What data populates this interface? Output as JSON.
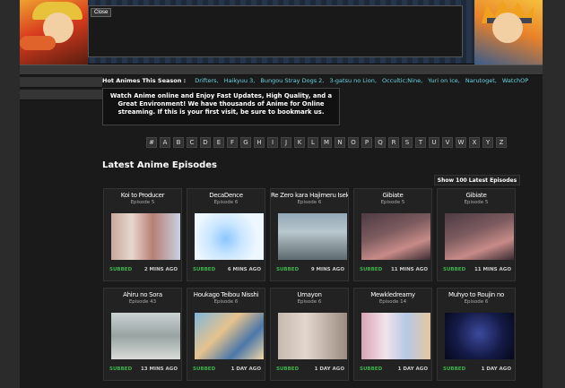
{
  "header": {
    "close_label": "Close"
  },
  "hot": {
    "label": "Hot Animes This Season :",
    "links": [
      "Drifters,",
      "Haikyuu 3,",
      "Bungou Stray Dogs 2,",
      "3-gatsu no Lion,",
      "Occultic;Nine,",
      "Yuri on Ice,",
      "Narutoget,",
      "WatchOP"
    ]
  },
  "welcome": "Watch Anime online and Enjoy Fast Updates, High Quality, and a Great Environment! We have thousands of Anime for Online streaming. If this is your first visit, be sure to bookmark us.",
  "alphabet": [
    "#",
    "A",
    "B",
    "C",
    "D",
    "E",
    "F",
    "G",
    "H",
    "I",
    "J",
    "K",
    "L",
    "M",
    "N",
    "O",
    "P",
    "Q",
    "R",
    "S",
    "T",
    "U",
    "V",
    "W",
    "X",
    "Y",
    "Z"
  ],
  "latest": {
    "title": "Latest Anime Episodes",
    "show_all": "Show 100 Latest Episodes",
    "episodes": [
      {
        "title": "Koi to Producer",
        "episode": "Episode 5",
        "status": "SUBBED",
        "ago": "2 MINS AGO"
      },
      {
        "title": "DecaDence",
        "episode": "Episode 6",
        "status": "SUBBED",
        "ago": "6 MINS AGO"
      },
      {
        "title": "Re Zero kara Hajimeru Isekai",
        "episode": "Episode 6",
        "status": "SUBBED",
        "ago": "9 MINS AGO"
      },
      {
        "title": "Gibiate",
        "episode": "Episode 5",
        "status": "SUBBED",
        "ago": "11 MINS AGO"
      },
      {
        "title": "Gibiate",
        "episode": "Episode 5",
        "status": "SUBBED",
        "ago": "11 MINS AGO"
      },
      {
        "title": "Ahiru no Sora",
        "episode": "Episode 43",
        "status": "SUBBED",
        "ago": "13 MINS AGO"
      },
      {
        "title": "Houkago Teibou Nisshi",
        "episode": "Episode 6",
        "status": "SUBBED",
        "ago": "1 DAY AGO"
      },
      {
        "title": "Umayon",
        "episode": "Episode 6",
        "status": "SUBBED",
        "ago": "1 DAY AGO"
      },
      {
        "title": "Mewkledreamy",
        "episode": "Episode 14",
        "status": "SUBBED",
        "ago": "1 DAY AGO"
      },
      {
        "title": "Muhyo to Roujin no",
        "episode": "Episode 6",
        "status": "SUBBED",
        "ago": "1 DAY AGO"
      }
    ]
  }
}
